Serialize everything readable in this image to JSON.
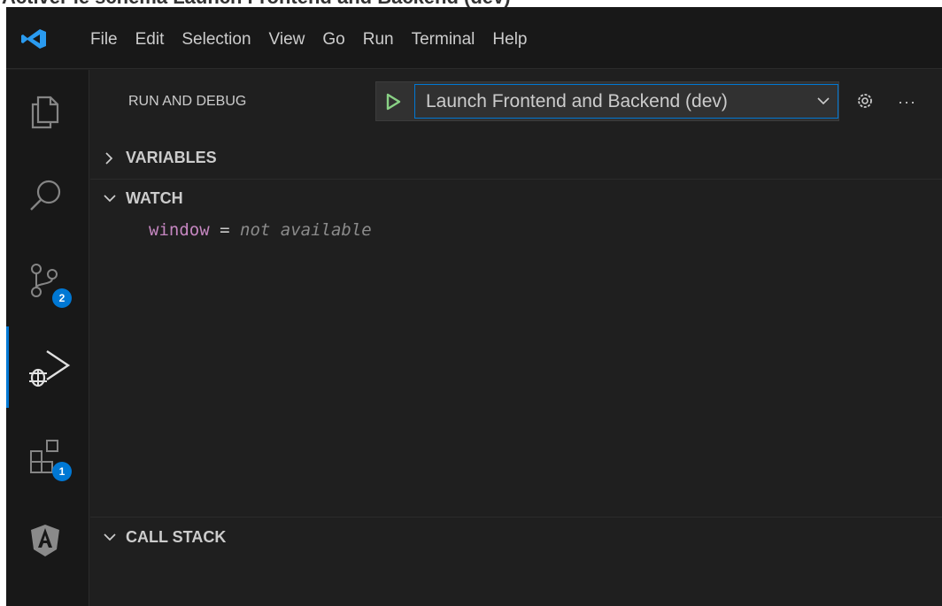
{
  "caption": "Activer le schéma Launch Frontend and Backend (dev)",
  "menu": [
    "File",
    "Edit",
    "Selection",
    "View",
    "Go",
    "Run",
    "Terminal",
    "Help"
  ],
  "activity_bar": {
    "source_control_badge": "2",
    "extensions_badge": "1"
  },
  "run_and_debug": {
    "title": "RUN AND DEBUG",
    "selected_config": "Launch Frontend and Backend (dev)",
    "more_label": "···"
  },
  "sections": {
    "variables": "VARIABLES",
    "watch": "WATCH",
    "call_stack": "CALL STACK"
  },
  "watch_expression": {
    "name": "window",
    "operator": "=",
    "value": "not available"
  },
  "colors": {
    "accent": "#0078d4",
    "play_green": "#89d185",
    "watch_name": "#c586c0"
  }
}
